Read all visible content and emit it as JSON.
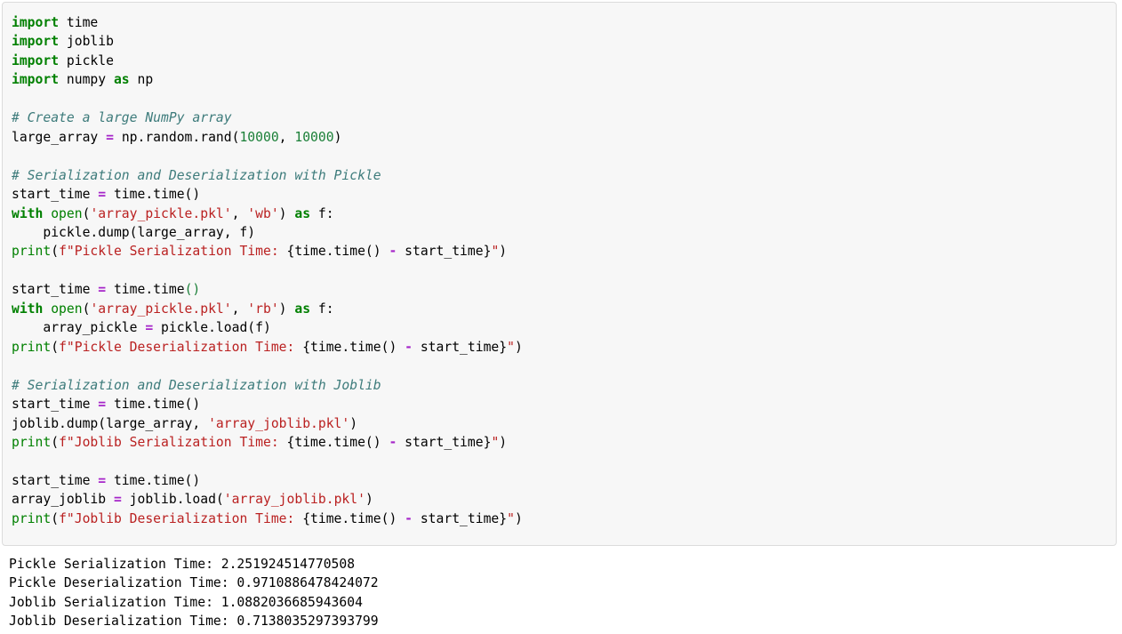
{
  "notebook": {
    "code_cell": {
      "language": "python",
      "background_color": "#f7f7f7",
      "border_color": "#dcdcdc",
      "lines": [
        "import time",
        "import joblib",
        "import pickle",
        "import numpy as np",
        "",
        "# Create a large NumPy array",
        "large_array = np.random.rand(10000, 10000)",
        "",
        "# Serialization and Deserialization with Pickle",
        "start_time = time.time()",
        "with open('array_pickle.pkl', 'wb') as f:",
        "    pickle.dump(large_array, f)",
        "print(f\"Pickle Serialization Time: {time.time() - start_time}\")",
        "",
        "start_time = time.time()",
        "with open('array_pickle.pkl', 'rb') as f:",
        "    array_pickle = pickle.load(f)",
        "print(f\"Pickle Deserialization Time: {time.time() - start_time}\")",
        "",
        "# Serialization and Deserialization with Joblib",
        "start_time = time.time()",
        "joblib.dump(large_array, 'array_joblib.pkl')",
        "print(f\"Joblib Serialization Time: {time.time() - start_time}\")",
        "",
        "start_time = time.time()",
        "array_joblib = joblib.load('array_joblib.pkl')",
        "print(f\"Joblib Deserialization Time: {time.time() - start_time}\")"
      ],
      "tokens": {
        "keywords": [
          "import",
          "with",
          "as"
        ],
        "comments": [
          "# Create a large NumPy array",
          "# Serialization and Deserialization with Pickle",
          "# Serialization and Deserialization with Joblib"
        ],
        "strings": [
          "'array_pickle.pkl'",
          "'wb'",
          "'rb'",
          "'array_joblib.pkl'"
        ],
        "builtins": [
          "print",
          "open"
        ],
        "operators": [
          "=",
          "-"
        ],
        "numbers": [
          "10000",
          "10000"
        ]
      },
      "colors": {
        "keyword": "#008000",
        "comment": "#3d7b7b",
        "string": "#ba2121",
        "builtin": "#008000",
        "operator": "#a625c9",
        "number": "#1a7f37",
        "plain": "#000000"
      }
    },
    "output_cell": {
      "lines": [
        "Pickle Serialization Time: 2.251924514770508",
        "Pickle Deserialization Time: 0.9710886478424072",
        "Joblib Serialization Time: 1.0882036685943604",
        "Joblib Deserialization Time: 0.7138035297393799"
      ],
      "results": [
        {
          "label": "Pickle Serialization Time",
          "value": "2.251924514770508"
        },
        {
          "label": "Pickle Deserialization Time",
          "value": "0.9710886478424072"
        },
        {
          "label": "Joblib Serialization Time",
          "value": "1.0882036685943604"
        },
        {
          "label": "Joblib Deserialization Time",
          "value": "0.7138035297393799"
        }
      ],
      "text_color": "#000000"
    }
  }
}
